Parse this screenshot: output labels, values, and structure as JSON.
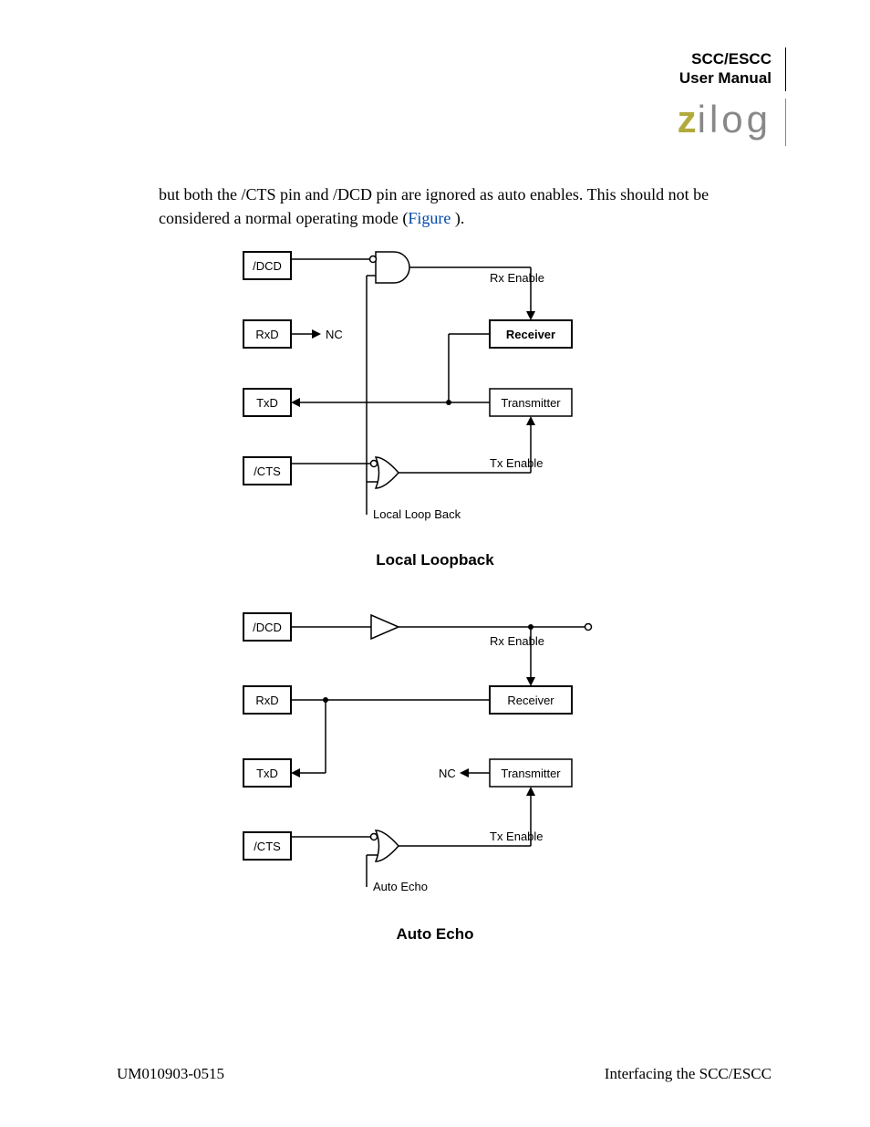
{
  "header": {
    "line1": "SCC/ESCC",
    "line2": "User Manual",
    "logo_z": "z",
    "logo_rest": "ilog"
  },
  "body": {
    "paragraph_pre": "but both the /CTS pin and /DCD pin are ignored as auto enables. This should not be considered a normal operating mode (",
    "figure_link": "Figure ",
    "paragraph_post": ")."
  },
  "diagram1": {
    "dcd": "/DCD",
    "rxd": "RxD",
    "txd": "TxD",
    "cts": "/CTS",
    "nc": "NC",
    "rx_enable": "Rx Enable",
    "tx_enable": "Tx Enable",
    "receiver": "Receiver",
    "transmitter": "Transmitter",
    "local_loopback_lbl": "Local Loop Back",
    "caption": "Local Loopback"
  },
  "diagram2": {
    "dcd": "/DCD",
    "rxd": "RxD",
    "txd": "TxD",
    "cts": "/CTS",
    "nc": "NC",
    "rx_enable": "Rx Enable",
    "tx_enable": "Tx Enable",
    "receiver": "Receiver",
    "transmitter": "Transmitter",
    "auto_echo_lbl": "Auto Echo",
    "caption": "Auto Echo"
  },
  "footer": {
    "left": "UM010903-0515",
    "right": "Interfacing the SCC/ESCC"
  }
}
